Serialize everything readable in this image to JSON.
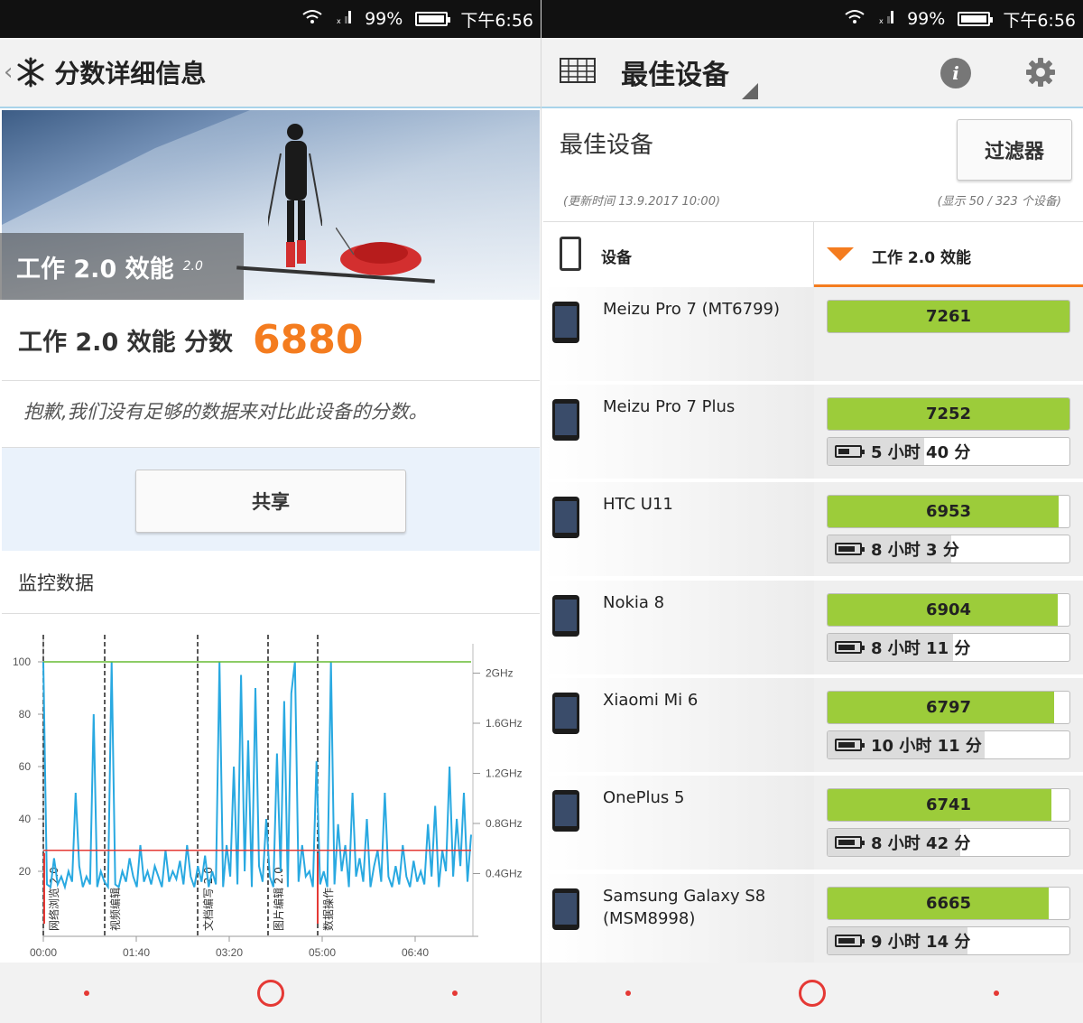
{
  "status": {
    "battery": "99%",
    "time": "下午6:56"
  },
  "left": {
    "title": "分数详细信息",
    "hero_caption": "工作 2.0 效能",
    "hero_version": "2.0",
    "score_label": "工作 2.0 效能 分数",
    "score_value": "6880",
    "message": "抱歉,我们没有足够的数据来对比此设备的分数。",
    "share_label": "共享",
    "monitor_title": "监控数据"
  },
  "chart_data": {
    "type": "line",
    "title": "",
    "xlabel": "",
    "ylabel": "",
    "x_ticks": [
      "00:00",
      "01:40",
      "03:20",
      "05:00",
      "06:40"
    ],
    "y_ticks": [
      20,
      40,
      60,
      80,
      100
    ],
    "y2_ticks": [
      "0.4GHz",
      "0.8GHz",
      "1.2GHz",
      "1.6GHz",
      "2GHz"
    ],
    "ylim": [
      0,
      100
    ],
    "markers": [
      "网络浏览 2.0",
      "视频编辑",
      "文档编写 2.0",
      "图片编辑 2.0",
      "数据操作"
    ],
    "series": [
      {
        "color": "#29a9e1",
        "values": [
          100,
          15,
          14,
          25,
          15,
          18,
          14,
          20,
          16,
          50,
          22,
          14,
          18,
          15,
          80,
          14,
          20,
          16,
          14,
          100,
          15,
          14,
          20,
          16,
          25,
          18,
          14,
          30,
          16,
          20,
          15,
          22,
          18,
          14,
          28,
          16,
          20,
          17,
          24,
          15,
          30,
          18,
          14,
          22,
          16,
          26,
          14,
          20,
          15,
          100,
          14,
          30,
          18,
          60,
          15,
          95,
          20,
          70,
          14,
          90,
          22,
          16,
          40,
          18,
          14,
          65,
          20,
          85,
          14,
          88,
          100,
          16,
          30,
          18,
          20,
          14,
          62,
          15,
          20,
          14,
          100,
          15,
          38,
          20,
          30,
          14,
          50,
          18,
          25,
          16,
          40,
          14,
          22,
          28,
          16,
          50,
          18,
          14,
          22,
          15,
          30,
          18,
          14,
          24,
          16,
          20,
          15,
          38,
          18,
          45,
          14,
          28,
          20,
          60,
          18,
          40,
          22,
          50,
          16,
          34
        ]
      },
      {
        "color": "#e53935",
        "values": [
          28,
          28,
          28,
          28,
          28,
          28,
          28,
          28,
          28,
          28,
          28,
          28,
          28,
          28,
          28,
          28,
          28,
          28,
          28,
          28,
          28,
          28,
          28,
          28,
          28,
          28,
          28,
          28,
          28,
          28,
          28,
          28,
          28,
          28,
          28,
          28,
          28,
          28,
          28,
          28,
          28,
          28,
          28,
          28,
          28,
          28,
          28,
          28,
          28,
          28,
          28,
          28,
          28,
          28,
          28,
          28,
          28,
          28,
          28,
          28,
          28,
          28,
          28,
          28,
          28,
          28,
          28,
          28,
          28,
          28,
          28,
          28,
          28,
          28,
          28,
          28,
          28,
          28,
          28,
          28,
          28,
          28,
          28,
          28,
          28,
          28,
          28,
          28,
          28,
          28,
          28,
          28,
          28,
          28,
          28,
          28,
          28,
          28,
          28,
          28,
          28,
          28,
          28,
          28,
          28,
          28,
          28,
          28,
          28,
          28,
          28,
          28,
          28,
          28,
          28,
          28,
          28,
          28,
          28,
          28,
          28
        ]
      },
      {
        "color": "#66bb33",
        "values": [
          100,
          100,
          100,
          100,
          100,
          100,
          100,
          100,
          100,
          100,
          100,
          100,
          100,
          100,
          100,
          100,
          100,
          100,
          100,
          100,
          100,
          100,
          100,
          100,
          100,
          100,
          100,
          100,
          100,
          100,
          100,
          100,
          100,
          100,
          100,
          100,
          100,
          100,
          100,
          100,
          100,
          100,
          100,
          100,
          100,
          100,
          100,
          100,
          100,
          100,
          100,
          100,
          100,
          100,
          100,
          100,
          100,
          100,
          100,
          100,
          100,
          100,
          100,
          100,
          100,
          100,
          100,
          100,
          100,
          100,
          100,
          100,
          100,
          100,
          100,
          100,
          100,
          100,
          100,
          100,
          100,
          100,
          100,
          100,
          100,
          100,
          100,
          100,
          100,
          100,
          100,
          100,
          100,
          100,
          100,
          100,
          100,
          100,
          100,
          100,
          100,
          100,
          100,
          100,
          100,
          100,
          100,
          100,
          100,
          100,
          100,
          100,
          100,
          100,
          100,
          100,
          100,
          100,
          100,
          100,
          100
        ]
      }
    ]
  },
  "right": {
    "title": "最佳设备",
    "section_title": "最佳设备",
    "filter_label": "过滤器",
    "updated": "(更新时间 13.9.2017 10:00)",
    "showing": "(显示 50 / 323 个设备)",
    "col_device": "设备",
    "col_perf": "工作 2.0 效能",
    "max_score": 7261,
    "devices": [
      {
        "name": "Meizu Pro 7 (MT6799)",
        "score": "7261",
        "ratio": 1.0,
        "battery": null
      },
      {
        "name": "Meizu Pro 7 Plus",
        "score": "7252",
        "ratio": 1.0,
        "battery": "5 小时 40 分",
        "battery_ratio": 0.4
      },
      {
        "name": "HTC U11",
        "score": "6953",
        "ratio": 0.955,
        "battery": "8 小时 3 分",
        "battery_ratio": 0.51
      },
      {
        "name": "Nokia 8",
        "score": "6904",
        "ratio": 0.95,
        "battery": "8 小时 11 分",
        "battery_ratio": 0.52
      },
      {
        "name": "Xiaomi Mi 6",
        "score": "6797",
        "ratio": 0.935,
        "battery": "10 小时 11 分",
        "battery_ratio": 0.65
      },
      {
        "name": "OnePlus 5",
        "score": "6741",
        "ratio": 0.925,
        "battery": "8 小时 42 分",
        "battery_ratio": 0.55
      },
      {
        "name": "Samsung Galaxy S8 (MSM8998)",
        "score": "6665",
        "ratio": 0.915,
        "battery": "9 小时 14 分",
        "battery_ratio": 0.58
      }
    ]
  },
  "colors": {
    "accent": "#f47c1f",
    "bar_green": "#9ccc3a",
    "nav_red": "#e53935"
  }
}
